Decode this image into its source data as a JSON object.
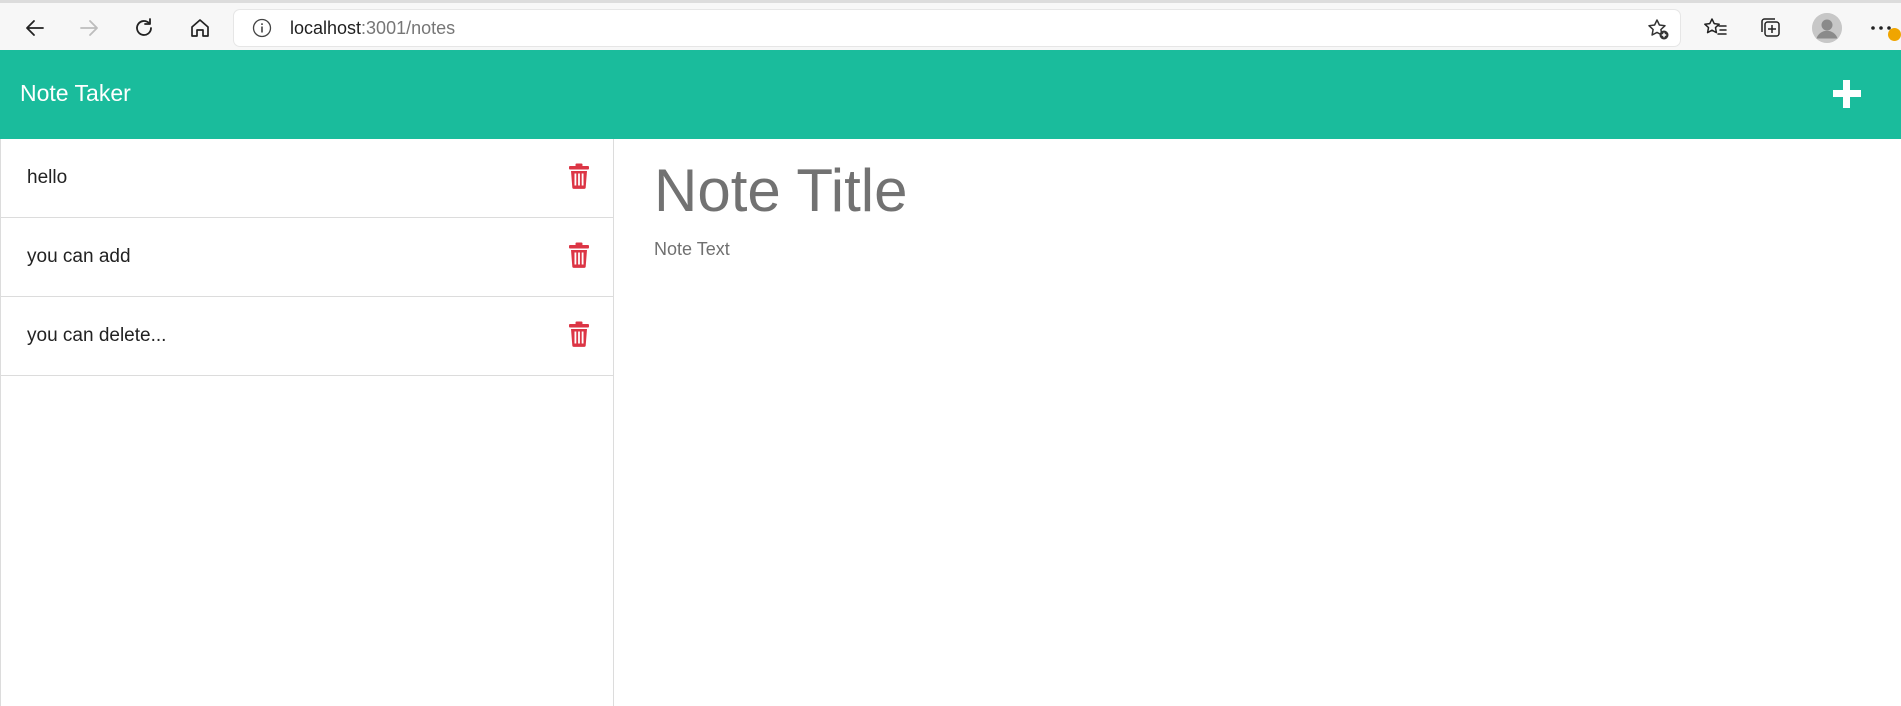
{
  "browser": {
    "url_host": "localhost",
    "url_rest": ":3001/notes",
    "icons": [
      "back-icon",
      "forward-icon",
      "refresh-icon",
      "home-icon",
      "info-icon",
      "add-favorite-icon",
      "favorites-icon",
      "collections-icon",
      "profile-icon",
      "more-icon"
    ]
  },
  "header": {
    "title": "Note Taker",
    "add_icon": "plus-icon"
  },
  "notes": [
    {
      "title": "hello"
    },
    {
      "title": "you can add"
    },
    {
      "title": "you can delete..."
    }
  ],
  "editor": {
    "title_placeholder": "Note Title",
    "text_placeholder": "Note Text"
  },
  "colors": {
    "accent": "#1abc9c",
    "delete": "#dc3545",
    "badge": "#f0a500"
  }
}
